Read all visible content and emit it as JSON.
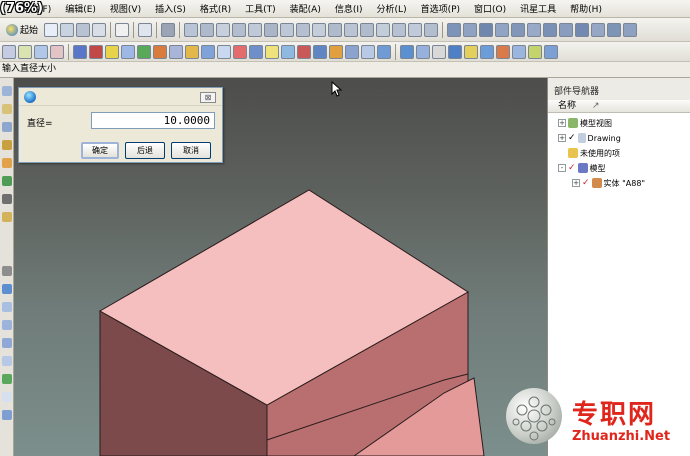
{
  "zoom_label": "(76%)",
  "menu": [
    "文件(F)",
    "编辑(E)",
    "视图(V)",
    "插入(S)",
    "格式(R)",
    "工具(T)",
    "装配(A)",
    "信息(I)",
    "分析(L)",
    "首选项(P)",
    "窗口(O)",
    "讯星工具",
    "帮助(H)"
  ],
  "toolbar": {
    "start_label": "起始"
  },
  "cue_line": "输入直径大小",
  "dialog": {
    "field_label": "直径=",
    "field_value": "10.0000",
    "ok_label": "确定",
    "back_label": "后退",
    "cancel_label": "取消",
    "close_symbol": "⊠"
  },
  "navigator": {
    "title": "部件导航器",
    "column_header": "名称",
    "sort_indicator": "↗",
    "items": [
      {
        "label": "模型视图",
        "expander": "+"
      },
      {
        "label": "Drawing",
        "expander": "+"
      },
      {
        "label": "未使用的项",
        "expander": ""
      },
      {
        "label": "模型",
        "expander": "-"
      },
      {
        "label": "实体 \"A88\"",
        "expander": "+"
      }
    ]
  },
  "watermark": {
    "cn": "专职网",
    "en": "Zhuanzhi.Net"
  },
  "colors": {
    "box_top": "#f6bfbf",
    "box_left": "#7c4a4a",
    "box_right": "#b96f6f",
    "watermark_red": "#e0261c"
  }
}
